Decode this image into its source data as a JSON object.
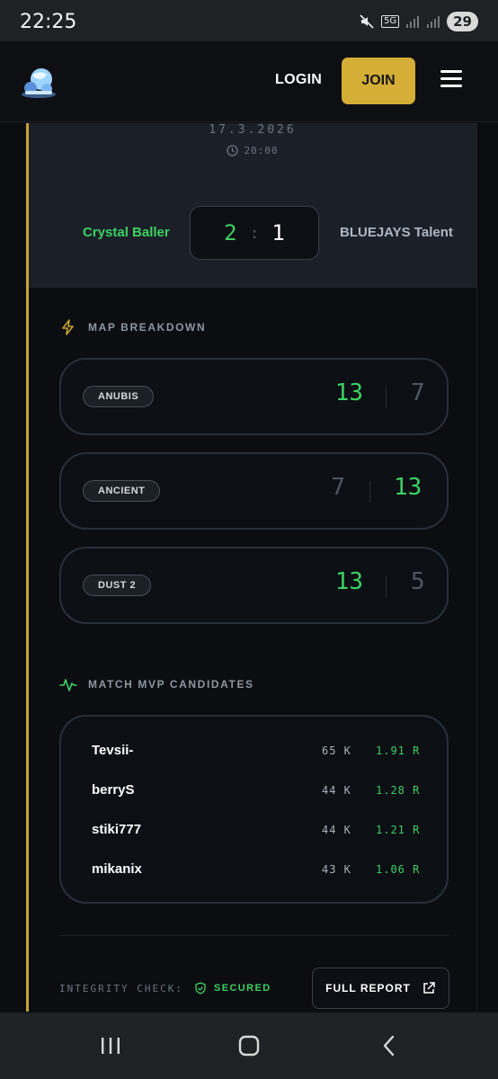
{
  "status_bar": {
    "time": "22:25",
    "battery": "29",
    "network": "5G",
    "icons": [
      "mute-icon",
      "5g-icon",
      "signal-icon",
      "signal-icon",
      "battery-icon"
    ]
  },
  "header": {
    "logo_icon": "globe-logo-icon",
    "login_label": "LOGIN",
    "join_label": "JOIN",
    "menu_icon": "hamburger-icon"
  },
  "match": {
    "date": "17.3.2026",
    "time": "20:00",
    "team_left": "Crystal Baller",
    "team_right": "BLUEJAYS Talent",
    "score_left": "2",
    "score_separator": ":",
    "score_right": "1"
  },
  "map_breakdown": {
    "title": "MAP BREAKDOWN",
    "icon": "lightning-icon",
    "maps": [
      {
        "name": "ANUBIS",
        "score_left": "13",
        "score_right": "7",
        "winner": "left"
      },
      {
        "name": "ANCIENT",
        "score_left": "7",
        "score_right": "13",
        "winner": "right"
      },
      {
        "name": "DUST 2",
        "score_left": "13",
        "score_right": "5",
        "winner": "left"
      }
    ]
  },
  "mvp": {
    "title": "MATCH MVP CANDIDATES",
    "icon": "activity-icon",
    "players": [
      {
        "name": "Tevsii-",
        "kills": "65 K",
        "rating": "1.91 R"
      },
      {
        "name": "berryS",
        "kills": "44 K",
        "rating": "1.28 R"
      },
      {
        "name": "stiki777",
        "kills": "44 K",
        "rating": "1.21 R"
      },
      {
        "name": "mikanix",
        "kills": "43 K",
        "rating": "1.06 R"
      }
    ]
  },
  "footer": {
    "integrity_label": "INTEGRITY CHECK:",
    "integrity_status": "SECURED",
    "full_report_label": "FULL REPORT"
  },
  "colors": {
    "accent_gold": "#d4ae36",
    "win_green": "#3dd163",
    "background": "#0b0d11"
  }
}
